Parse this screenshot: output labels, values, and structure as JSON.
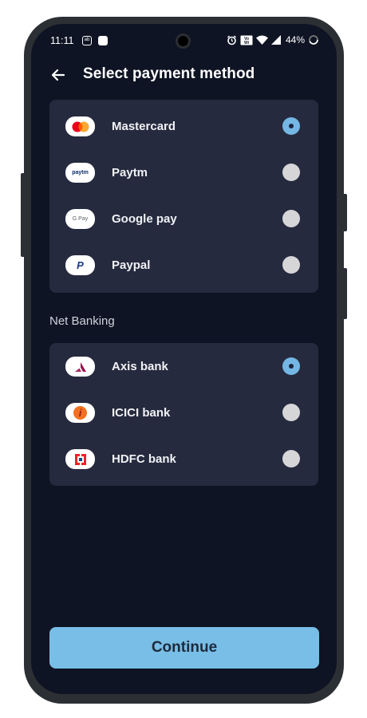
{
  "status_bar": {
    "time": "11:11",
    "battery": "44%",
    "icons": [
      "notification-icon",
      "image-icon",
      "alarm-icon",
      "volte-icon",
      "wifi-icon",
      "signal-icon",
      "battery-icon"
    ]
  },
  "header": {
    "title": "Select payment method",
    "back_icon": "arrow-left-icon"
  },
  "payment_methods": [
    {
      "label": "Mastercard",
      "logo": "mastercard-logo",
      "selected": true
    },
    {
      "label": "Paytm",
      "logo": "paytm-logo",
      "logo_text": "paytm",
      "selected": false
    },
    {
      "label": "Google pay",
      "logo": "google-pay-logo",
      "logo_text": "G Pay",
      "selected": false
    },
    {
      "label": "Paypal",
      "logo": "paypal-logo",
      "logo_text": "P",
      "selected": false
    }
  ],
  "net_banking": {
    "section_label": "Net Banking",
    "banks": [
      {
        "label": "Axis bank",
        "logo": "axis-bank-logo",
        "selected": true
      },
      {
        "label": "ICICI bank",
        "logo": "icici-bank-logo",
        "logo_text": "i",
        "selected": false
      },
      {
        "label": "HDFC bank",
        "logo": "hdfc-bank-logo",
        "selected": false
      }
    ]
  },
  "continue_label": "Continue",
  "colors": {
    "background": "#0f1424",
    "card": "#262a3e",
    "accent": "#78bee6",
    "radio_unselected": "#d6d6d9"
  }
}
